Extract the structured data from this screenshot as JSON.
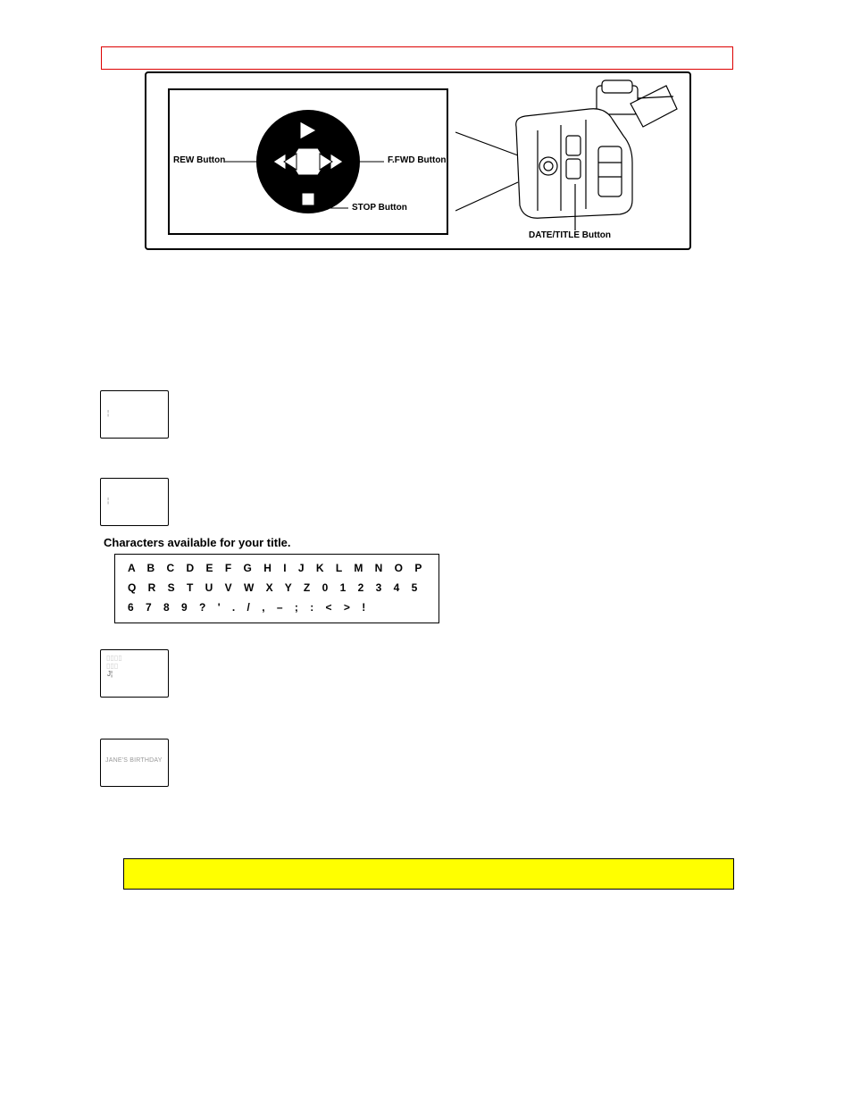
{
  "diagram": {
    "rew_label": "REW Button",
    "ffwd_label": "F.FWD Button",
    "stop_label": "STOP Button",
    "date_title_label": "DATE/TITLE Button"
  },
  "chars_heading": "Characters available for your title.",
  "chars": {
    "row1": "A B C D E F G H I J K L M N O P",
    "row2": "Q R S T U V W X Y Z 0 1 2 3 4 5",
    "row3": "6 7 8 9 ? ' . / , – ; : < > !"
  },
  "preview4_text": "JANE'S BIRTHDAY"
}
